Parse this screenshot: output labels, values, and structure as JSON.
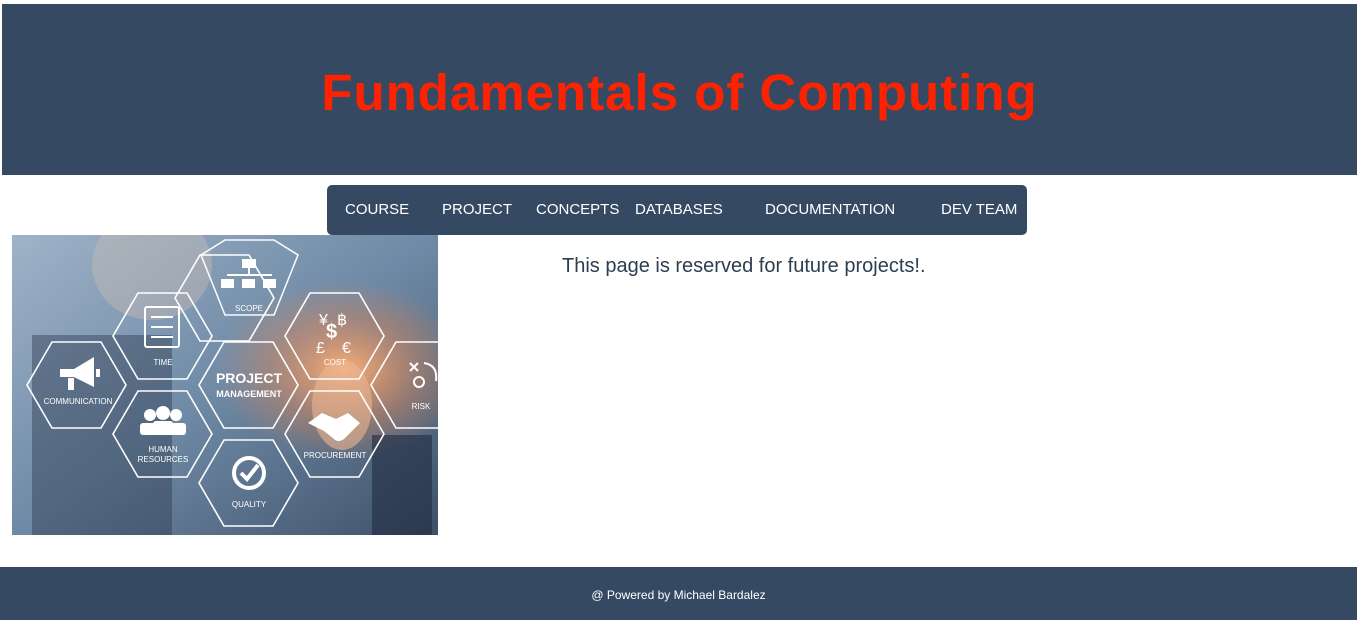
{
  "header": {
    "title": "Fundamentals of Computing"
  },
  "nav": {
    "items": [
      {
        "label": "COURSE"
      },
      {
        "label": "PROJECT"
      },
      {
        "label": "CONCEPTS"
      },
      {
        "label": "DATABASES"
      },
      {
        "label": "DOCUMENTATION"
      },
      {
        "label": "DEV TEAM"
      }
    ]
  },
  "hero_image": {
    "hexagons": {
      "scope": "SCOPE",
      "time": "TIME",
      "cost": "COST",
      "communication": "COMMUNICATION",
      "center_line1": "PROJECT",
      "center_line2": "MANAGEMENT",
      "risk": "RISK",
      "human_resources_line1": "HUMAN",
      "human_resources_line2": "RESOURCES",
      "procurement": "PROCUREMENT",
      "quality": "QUALITY"
    }
  },
  "main": {
    "message": "This page is reserved for future projects!."
  },
  "footer": {
    "text": "@ Powered by Michael Bardalez"
  },
  "colors": {
    "header_bg": "#354a62",
    "title": "#ff2200",
    "nav_bg": "#354a62",
    "nav_text": "#ffffff",
    "footer_bg": "#354a62",
    "body_text": "#2c3e50"
  }
}
